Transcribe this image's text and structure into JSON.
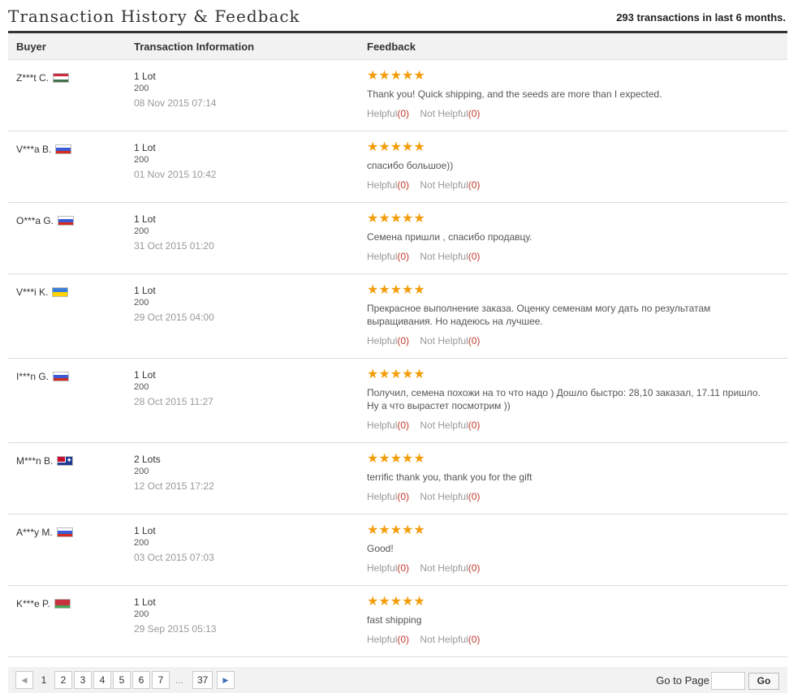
{
  "header": {
    "title": "Transaction History & Feedback",
    "summary": "293 transactions in last 6 months."
  },
  "columns": {
    "buyer": "Buyer",
    "info": "Transaction Information",
    "feedback": "Feedback"
  },
  "labels": {
    "helpful": "Helpful",
    "not_helpful": "Not Helpful",
    "stars": "★★★★★"
  },
  "rows": [
    {
      "buyer": "Z***t C.",
      "flag": "hu",
      "lots": "1 Lot",
      "qty": "200",
      "date": "08 Nov 2015 07:14",
      "rating": 5,
      "comment": "Thank you! Quick shipping, and the seeds are more than I expected.",
      "helpful": "(0)",
      "not_helpful": "(0)"
    },
    {
      "buyer": "V***a B.",
      "flag": "ru",
      "lots": "1 Lot",
      "qty": "200",
      "date": "01 Nov 2015 10:42",
      "rating": 5,
      "comment": "спасибо большое))",
      "helpful": "(0)",
      "not_helpful": "(0)"
    },
    {
      "buyer": "O***a G.",
      "flag": "ru",
      "lots": "1 Lot",
      "qty": "200",
      "date": "31 Oct 2015 01:20",
      "rating": 5,
      "comment": "Семена пришли , спасибо продавцу.",
      "helpful": "(0)",
      "not_helpful": "(0)"
    },
    {
      "buyer": "V***i K.",
      "flag": "ua",
      "lots": "1 Lot",
      "qty": "200",
      "date": "29 Oct 2015 04:00",
      "rating": 5,
      "comment": "Прекрасное выполнение заказа. Оценку семенам могу дать по результатам выращивания. Но надеюсь на лучшее.",
      "helpful": "(0)",
      "not_helpful": "(0)"
    },
    {
      "buyer": "I***n G.",
      "flag": "ru",
      "lots": "1 Lot",
      "qty": "200",
      "date": "28 Oct 2015 11:27",
      "rating": 5,
      "comment": "Получил, семена похожи на то что надо ) Дошло быстро: 28,10 заказал, 17.11 пришло. Ну а что вырастет посмотрим ))",
      "helpful": "(0)",
      "not_helpful": "(0)"
    },
    {
      "buyer": "M***n B.",
      "flag": "au",
      "lots": "2 Lots",
      "qty": "200",
      "date": "12 Oct 2015 17:22",
      "rating": 5,
      "comment": "terrific thank you, thank you for the gift",
      "helpful": "(0)",
      "not_helpful": "(0)"
    },
    {
      "buyer": "A***y M.",
      "flag": "ru",
      "lots": "1 Lot",
      "qty": "200",
      "date": "03 Oct 2015 07:03",
      "rating": 5,
      "comment": "Good!",
      "helpful": "(0)",
      "not_helpful": "(0)"
    },
    {
      "buyer": "K***e P.",
      "flag": "by",
      "lots": "1 Lot",
      "qty": "200",
      "date": "29 Sep 2015 05:13",
      "rating": 5,
      "comment": "fast shipping",
      "helpful": "(0)",
      "not_helpful": "(0)"
    }
  ],
  "pager": {
    "prev": "◀",
    "next": "▶",
    "pages": [
      "1",
      "2",
      "3",
      "4",
      "5",
      "6",
      "7"
    ],
    "current": "1",
    "ellipsis": "...",
    "last": "37",
    "goto_label": "Go to Page",
    "go_button": "Go",
    "goto_value": ""
  },
  "colors": {
    "star": "#f49d0b",
    "count": "#c0392b",
    "header_bg": "#f2f2f2",
    "top_rule": "#333333"
  }
}
